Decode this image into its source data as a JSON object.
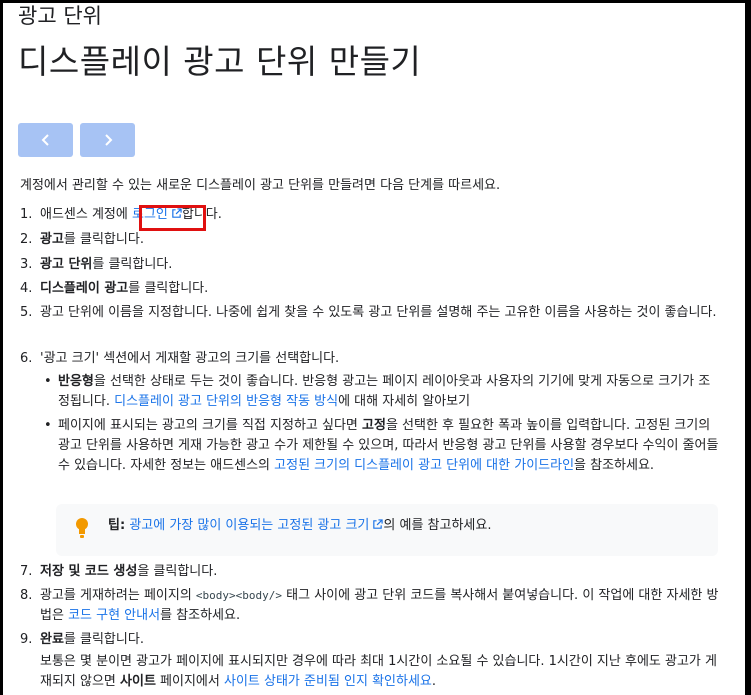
{
  "breadcrumb": "광고 단위",
  "title": "디스플레이 광고 단위 만들기",
  "nav": {
    "prev": "previous-arrow",
    "next": "next-arrow"
  },
  "intro": "계정에서 관리할 수 있는 새로운 디스플레이 광고 단위를 만들려면 다음 단계를 따르세요.",
  "steps": {
    "s1": {
      "num": "1.",
      "pre": "애드센스 계정에 ",
      "link": "로그인",
      "post": "합니다."
    },
    "s2": {
      "num": "2.",
      "bold": "광고",
      "post": "를 클릭합니다."
    },
    "s3": {
      "num": "3.",
      "bold": "광고 단위",
      "post": "를 클릭합니다."
    },
    "s4": {
      "num": "4.",
      "bold": "디스플레이 광고",
      "post": "를 클릭합니다."
    },
    "s5": {
      "num": "5.",
      "text": "광고 단위에 이름을 지정합니다. 나중에 쉽게 찾을 수 있도록 광고 단위를 설명해 주는 고유한 이름을 사용하는 것이 좋습니다."
    },
    "s6": {
      "num": "6.",
      "text": "'광고 크기' 섹션에서 게재할 광고의 크기를 선택합니다.",
      "b1": {
        "bold": "반응형",
        "text": "을 선택한 상태로 두는 것이 좋습니다. 반응형 광고는 페이지 레이아웃과 사용자의 기기에 맞게 자동으로 크기가 조정됩니다. ",
        "link": "디스플레이 광고 단위의 반응형 작동 방식",
        "post": "에 대해 자세히 알아보기"
      },
      "b2": {
        "pre": "페이지에 표시되는 광고의 크기를 직접 지정하고 싶다면 ",
        "bold": "고정",
        "text": "을 선택한 후 필요한 폭과 높이를 입력합니다. 고정된 크기의 광고 단위를 사용하면 게재 가능한 광고 수가 제한될 수 있으며, 따라서 반응형 광고 단위를 사용할 경우보다 수익이 줄어들 수 있습니다. 자세한 정보는 애드센스의 ",
        "link": "고정된 크기의 디스플레이 광고 단위에 대한 가이드라인",
        "post": "을 참조하세요."
      },
      "tip": {
        "label": "팁:",
        "link": "광고에 가장 많이 이용되는 고정된 광고 크기",
        "post": "의 예를 참고하세요."
      }
    },
    "s7": {
      "num": "7.",
      "bold": "저장 및 코드 생성",
      "post": "을 클릭합니다."
    },
    "s8": {
      "num": "8.",
      "pre": "광고를 게재하려는 페이지의 ",
      "code": "<body><body/>",
      "text": " 태그 사이에 광고 단위 코드를 복사해서 붙여넣습니다. 이 작업에 대한 자세한 방법은 ",
      "link": "코드 구현 안내서",
      "post": "를 참조하세요."
    },
    "s9": {
      "num": "9.",
      "bold": "완료",
      "post": "를 클릭합니다.",
      "extra": "보통은 몇 분이면 광고가 페이지에 표시되지만 경우에 따라 최대 1시간이 소요될 수 있습니다. 1시간이 지난 후에도 광고가 게재되지 않으면 ",
      "extra_bold": "사이트",
      "extra_mid": " 페이지에서 ",
      "extra_link": "사이트 상태가 준비됨 인지 확인하세요",
      "extra_post": "."
    }
  },
  "colors": {
    "link": "#1a73e8",
    "nav_button": "#a7c3f4",
    "highlight": "#e01010",
    "tip_bulb": "#f29900"
  }
}
